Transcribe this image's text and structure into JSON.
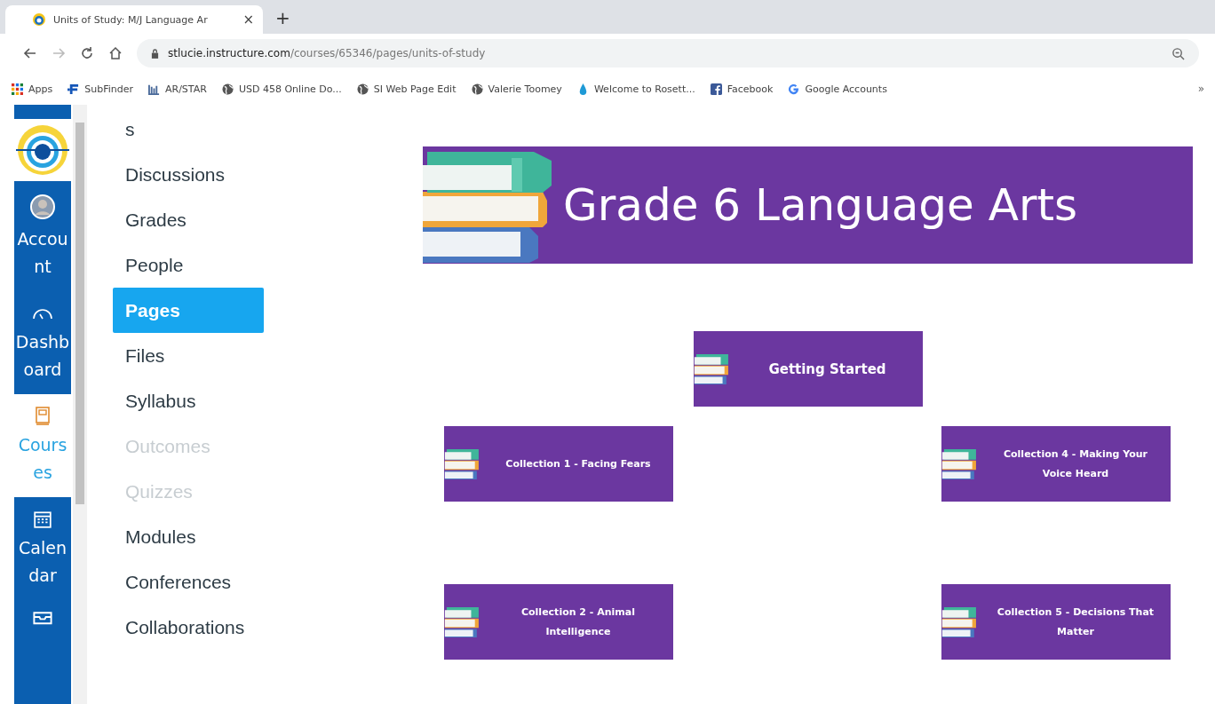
{
  "browser": {
    "tab": {
      "title": "Units of Study: M/J Language Ar",
      "close": "×",
      "new_tab": "+"
    },
    "address": {
      "domain": "stlucie.instructure.com",
      "path": "/courses/65346/pages/units-of-study"
    },
    "bookmarks": [
      {
        "kind": "apps",
        "label": "Apps"
      },
      {
        "kind": "logo",
        "label": "SubFinder"
      },
      {
        "kind": "bars",
        "label": "AR/STAR"
      },
      {
        "kind": "globe",
        "label": "USD 458 Online Do..."
      },
      {
        "kind": "globe",
        "label": "SI Web Page Edit"
      },
      {
        "kind": "globe",
        "label": "Valerie Toomey"
      },
      {
        "kind": "drop",
        "label": "Welcome to Rosett..."
      },
      {
        "kind": "facebook",
        "label": "Facebook"
      },
      {
        "kind": "google",
        "label": "Google Accounts"
      }
    ],
    "more": "»"
  },
  "global_nav": [
    {
      "kind": "account",
      "label": "Account",
      "selected": false
    },
    {
      "kind": "dashboard",
      "label": "Dashboard",
      "selected": false
    },
    {
      "kind": "courses",
      "label": "Courses",
      "selected": true
    },
    {
      "kind": "calendar",
      "label": "Calendar",
      "selected": false
    }
  ],
  "course_nav": [
    {
      "label": "s",
      "selected": false,
      "disabled": false
    },
    {
      "label": "Discussions",
      "selected": false,
      "disabled": false
    },
    {
      "label": "Grades",
      "selected": false,
      "disabled": false
    },
    {
      "label": "People",
      "selected": false,
      "disabled": false
    },
    {
      "label": "Pages",
      "selected": true,
      "disabled": false
    },
    {
      "label": "Files",
      "selected": false,
      "disabled": false
    },
    {
      "label": "Syllabus",
      "selected": false,
      "disabled": false
    },
    {
      "label": "Outcomes",
      "selected": false,
      "disabled": true
    },
    {
      "label": "Quizzes",
      "selected": false,
      "disabled": true
    },
    {
      "label": "Modules",
      "selected": false,
      "disabled": false
    },
    {
      "label": "Conferences",
      "selected": false,
      "disabled": false
    },
    {
      "label": "Collaborations",
      "selected": false,
      "disabled": false
    }
  ],
  "banner": {
    "title": "Grade 6 Language Arts"
  },
  "featured_tile": {
    "label": "Getting Started"
  },
  "left_tiles": [
    {
      "label": "Collection 1 - Facing Fears"
    },
    {
      "label": "Collection 2 - Animal Intelligence"
    }
  ],
  "right_tiles": [
    {
      "label": "Collection 4 - Making Your Voice Heard"
    },
    {
      "label": "Collection 5 - Decisions That Matter"
    }
  ]
}
